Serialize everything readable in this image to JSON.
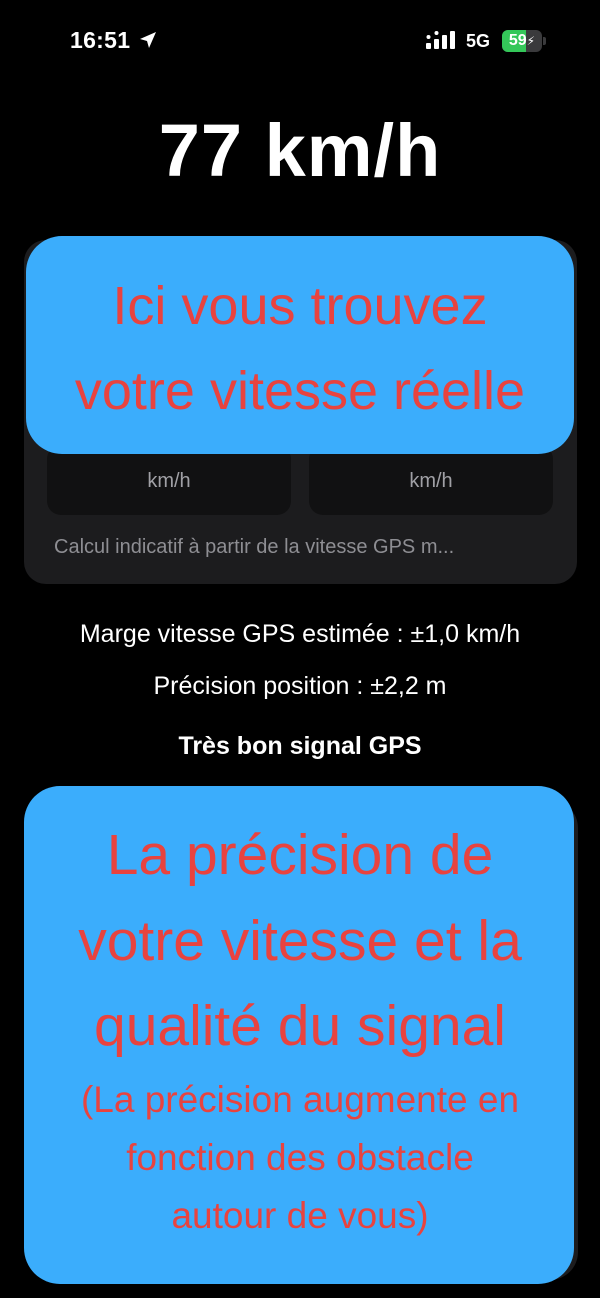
{
  "status_bar": {
    "time": "16:51",
    "network": "5G",
    "battery_percent": "59",
    "battery_level": 0.59,
    "battery_color": "#34c759"
  },
  "speed": {
    "display": "77 km/h"
  },
  "card": {
    "left_unit": "km/h",
    "right_unit": "km/h",
    "note": "Calcul indicatif à partir de la vitesse GPS m..."
  },
  "gps": {
    "margin": "Marge vitesse GPS estimée : ±1,0 km/h",
    "precision": "Précision position : ±2,2 m",
    "signal_quality": "Très bon signal GPS"
  },
  "overlay_top": {
    "line1": "Ici vous trouvez",
    "line2": "votre vitesse réelle"
  },
  "overlay_bottom": {
    "line1": "La précision de",
    "line2": "votre vitesse et la",
    "line3": "qualité du signal",
    "line4": "(La précision augmente en",
    "line5": "fonction des obstacle",
    "line6": "autour de vous)"
  },
  "colors": {
    "overlay_bg": "#3badfc",
    "overlay_text": "#e8433f",
    "card_bg": "#1c1c1e"
  },
  "icons": {
    "location": "location-arrow-icon",
    "signal": "cellular-signal-icon",
    "battery": "battery-charging-icon"
  }
}
